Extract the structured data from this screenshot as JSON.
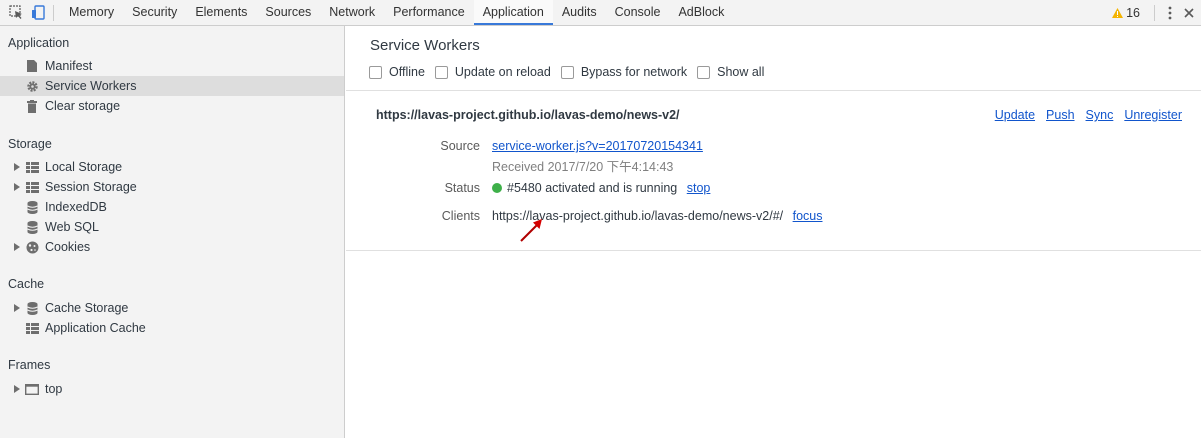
{
  "toolbar": {
    "tabs": [
      "Memory",
      "Security",
      "Elements",
      "Sources",
      "Network",
      "Performance",
      "Application",
      "Audits",
      "Console",
      "AdBlock"
    ],
    "active_tab": "Application",
    "warning_count": "16",
    "accent_color": "#3879d9"
  },
  "sidebar": {
    "application": {
      "title": "Application",
      "items": [
        "Manifest",
        "Service Workers",
        "Clear storage"
      ]
    },
    "storage": {
      "title": "Storage",
      "items": [
        "Local Storage",
        "Session Storage",
        "IndexedDB",
        "Web SQL",
        "Cookies"
      ]
    },
    "cache": {
      "title": "Cache",
      "items": [
        "Cache Storage",
        "Application Cache"
      ]
    },
    "frames": {
      "title": "Frames",
      "items": [
        "top"
      ]
    },
    "selected": "Service Workers"
  },
  "main": {
    "title": "Service Workers",
    "options": [
      "Offline",
      "Update on reload",
      "Bypass for network",
      "Show all"
    ],
    "scope": "https://lavas-project.github.io/lavas-demo/news-v2/",
    "actions": [
      "Update",
      "Push",
      "Sync",
      "Unregister"
    ],
    "source_label": "Source",
    "source_link": "service-worker.js?v=20170720154341",
    "received": "Received 2017/7/20 下午4:14:43",
    "status_label": "Status",
    "status_text": "#5480 activated and is running",
    "status_action": "stop",
    "status_color": "#3eb049",
    "clients_label": "Clients",
    "clients_url": "https://lavas-project.github.io/lavas-demo/news-v2/#/",
    "clients_action": "focus"
  }
}
